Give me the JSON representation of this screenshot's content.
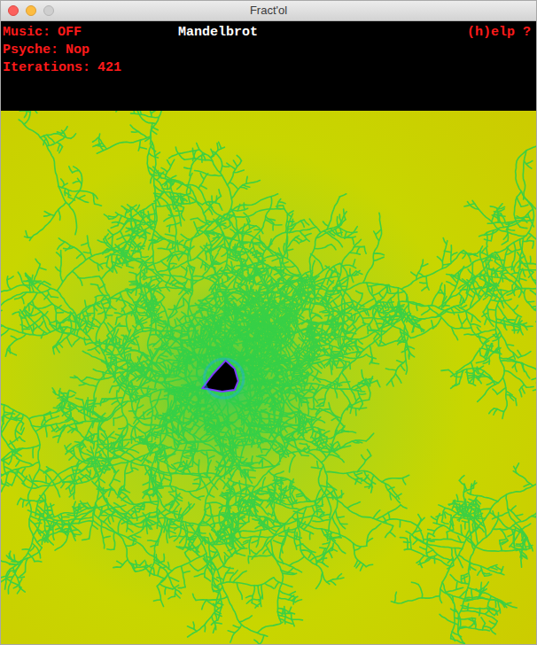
{
  "window": {
    "title": "Fract'ol"
  },
  "header": {
    "status": [
      {
        "label": "Music:",
        "value": "OFF"
      },
      {
        "label": "Psyche:",
        "value": "Nop"
      },
      {
        "label": "Iterations:",
        "value": "421"
      }
    ],
    "fractal_name": "Mandelbrot",
    "help": "(h)elp ?"
  }
}
